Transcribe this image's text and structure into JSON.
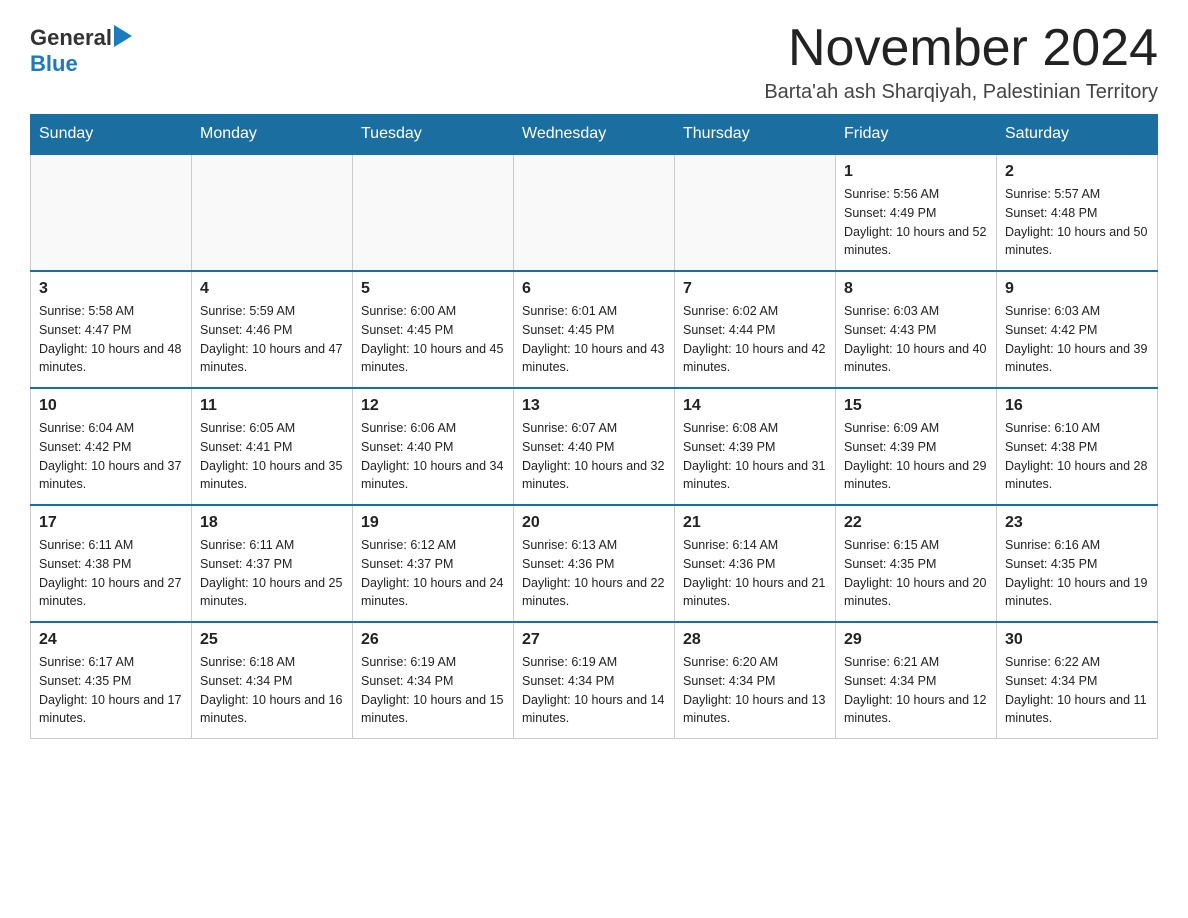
{
  "logo": {
    "general": "General",
    "blue": "Blue",
    "arrow": "▶"
  },
  "title": "November 2024",
  "subtitle": "Barta'ah ash Sharqiyah, Palestinian Territory",
  "weekdays": [
    "Sunday",
    "Monday",
    "Tuesday",
    "Wednesday",
    "Thursday",
    "Friday",
    "Saturday"
  ],
  "weeks": [
    [
      {
        "day": "",
        "info": ""
      },
      {
        "day": "",
        "info": ""
      },
      {
        "day": "",
        "info": ""
      },
      {
        "day": "",
        "info": ""
      },
      {
        "day": "",
        "info": ""
      },
      {
        "day": "1",
        "info": "Sunrise: 5:56 AM\nSunset: 4:49 PM\nDaylight: 10 hours and 52 minutes."
      },
      {
        "day": "2",
        "info": "Sunrise: 5:57 AM\nSunset: 4:48 PM\nDaylight: 10 hours and 50 minutes."
      }
    ],
    [
      {
        "day": "3",
        "info": "Sunrise: 5:58 AM\nSunset: 4:47 PM\nDaylight: 10 hours and 48 minutes."
      },
      {
        "day": "4",
        "info": "Sunrise: 5:59 AM\nSunset: 4:46 PM\nDaylight: 10 hours and 47 minutes."
      },
      {
        "day": "5",
        "info": "Sunrise: 6:00 AM\nSunset: 4:45 PM\nDaylight: 10 hours and 45 minutes."
      },
      {
        "day": "6",
        "info": "Sunrise: 6:01 AM\nSunset: 4:45 PM\nDaylight: 10 hours and 43 minutes."
      },
      {
        "day": "7",
        "info": "Sunrise: 6:02 AM\nSunset: 4:44 PM\nDaylight: 10 hours and 42 minutes."
      },
      {
        "day": "8",
        "info": "Sunrise: 6:03 AM\nSunset: 4:43 PM\nDaylight: 10 hours and 40 minutes."
      },
      {
        "day": "9",
        "info": "Sunrise: 6:03 AM\nSunset: 4:42 PM\nDaylight: 10 hours and 39 minutes."
      }
    ],
    [
      {
        "day": "10",
        "info": "Sunrise: 6:04 AM\nSunset: 4:42 PM\nDaylight: 10 hours and 37 minutes."
      },
      {
        "day": "11",
        "info": "Sunrise: 6:05 AM\nSunset: 4:41 PM\nDaylight: 10 hours and 35 minutes."
      },
      {
        "day": "12",
        "info": "Sunrise: 6:06 AM\nSunset: 4:40 PM\nDaylight: 10 hours and 34 minutes."
      },
      {
        "day": "13",
        "info": "Sunrise: 6:07 AM\nSunset: 4:40 PM\nDaylight: 10 hours and 32 minutes."
      },
      {
        "day": "14",
        "info": "Sunrise: 6:08 AM\nSunset: 4:39 PM\nDaylight: 10 hours and 31 minutes."
      },
      {
        "day": "15",
        "info": "Sunrise: 6:09 AM\nSunset: 4:39 PM\nDaylight: 10 hours and 29 minutes."
      },
      {
        "day": "16",
        "info": "Sunrise: 6:10 AM\nSunset: 4:38 PM\nDaylight: 10 hours and 28 minutes."
      }
    ],
    [
      {
        "day": "17",
        "info": "Sunrise: 6:11 AM\nSunset: 4:38 PM\nDaylight: 10 hours and 27 minutes."
      },
      {
        "day": "18",
        "info": "Sunrise: 6:11 AM\nSunset: 4:37 PM\nDaylight: 10 hours and 25 minutes."
      },
      {
        "day": "19",
        "info": "Sunrise: 6:12 AM\nSunset: 4:37 PM\nDaylight: 10 hours and 24 minutes."
      },
      {
        "day": "20",
        "info": "Sunrise: 6:13 AM\nSunset: 4:36 PM\nDaylight: 10 hours and 22 minutes."
      },
      {
        "day": "21",
        "info": "Sunrise: 6:14 AM\nSunset: 4:36 PM\nDaylight: 10 hours and 21 minutes."
      },
      {
        "day": "22",
        "info": "Sunrise: 6:15 AM\nSunset: 4:35 PM\nDaylight: 10 hours and 20 minutes."
      },
      {
        "day": "23",
        "info": "Sunrise: 6:16 AM\nSunset: 4:35 PM\nDaylight: 10 hours and 19 minutes."
      }
    ],
    [
      {
        "day": "24",
        "info": "Sunrise: 6:17 AM\nSunset: 4:35 PM\nDaylight: 10 hours and 17 minutes."
      },
      {
        "day": "25",
        "info": "Sunrise: 6:18 AM\nSunset: 4:34 PM\nDaylight: 10 hours and 16 minutes."
      },
      {
        "day": "26",
        "info": "Sunrise: 6:19 AM\nSunset: 4:34 PM\nDaylight: 10 hours and 15 minutes."
      },
      {
        "day": "27",
        "info": "Sunrise: 6:19 AM\nSunset: 4:34 PM\nDaylight: 10 hours and 14 minutes."
      },
      {
        "day": "28",
        "info": "Sunrise: 6:20 AM\nSunset: 4:34 PM\nDaylight: 10 hours and 13 minutes."
      },
      {
        "day": "29",
        "info": "Sunrise: 6:21 AM\nSunset: 4:34 PM\nDaylight: 10 hours and 12 minutes."
      },
      {
        "day": "30",
        "info": "Sunrise: 6:22 AM\nSunset: 4:34 PM\nDaylight: 10 hours and 11 minutes."
      }
    ]
  ]
}
